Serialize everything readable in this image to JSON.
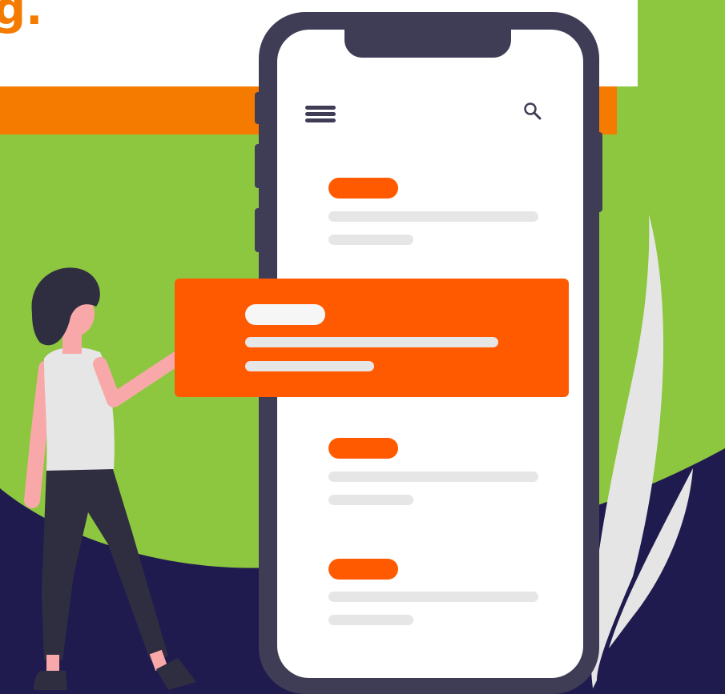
{
  "header": {
    "title_fragment": "g."
  },
  "app": {
    "menu_icon": "hamburger-menu-icon",
    "search_icon": "search-icon"
  },
  "list": {
    "items": [
      {
        "state": "default"
      },
      {
        "state": "selected"
      },
      {
        "state": "default"
      },
      {
        "state": "default"
      }
    ]
  },
  "colors": {
    "green": "#8DC63F",
    "navy": "#201B4F",
    "orange": "#FF5A00",
    "header_orange": "#F47A00",
    "phone_frame": "#3F3D56",
    "placeholder_gray": "#E6E6E6",
    "leaf_gray": "#E5E5E5"
  }
}
